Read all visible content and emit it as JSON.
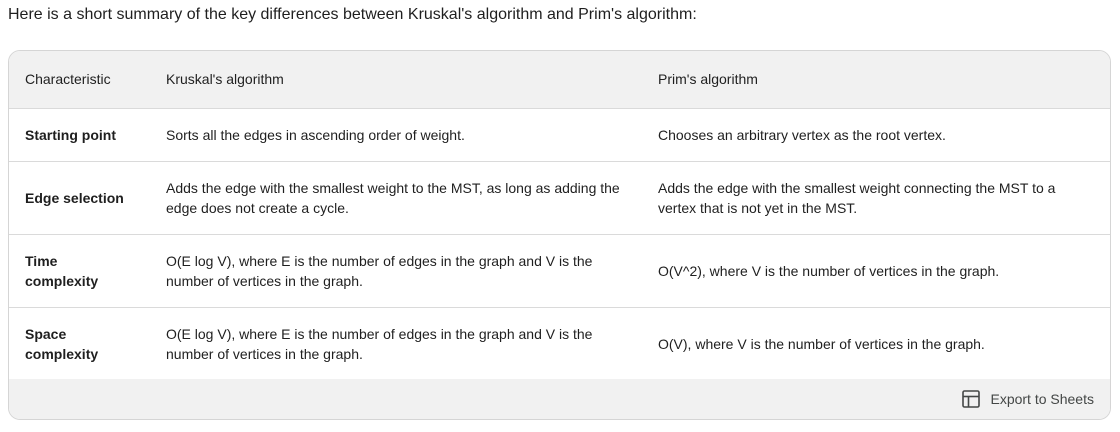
{
  "intro": "Here is a short summary of the key differences between Kruskal's algorithm and Prim's algorithm:",
  "table": {
    "headers": [
      "Characteristic",
      "Kruskal's algorithm",
      "Prim's algorithm"
    ],
    "rows": [
      [
        "Starting point",
        "Sorts all the edges in ascending order of weight.",
        "Chooses an arbitrary vertex as the root vertex."
      ],
      [
        "Edge selection",
        "Adds the edge with the smallest weight to the MST, as long as adding the edge does not create a cycle.",
        "Adds the edge with the smallest weight connecting the MST to a vertex that is not yet in the MST."
      ],
      [
        "Time complexity",
        "O(E log V), where E is the number of edges in the graph and V is the number of vertices in the graph.",
        "O(V^2), where V is the number of vertices in the graph."
      ],
      [
        "Space complexity",
        "O(E log V), where E is the number of edges in the graph and V is the number of vertices in the graph.",
        "O(V), where V is the number of vertices in the graph."
      ]
    ]
  },
  "footer": {
    "export_label": "Export to Sheets",
    "export_icon": "table-grid-icon"
  }
}
